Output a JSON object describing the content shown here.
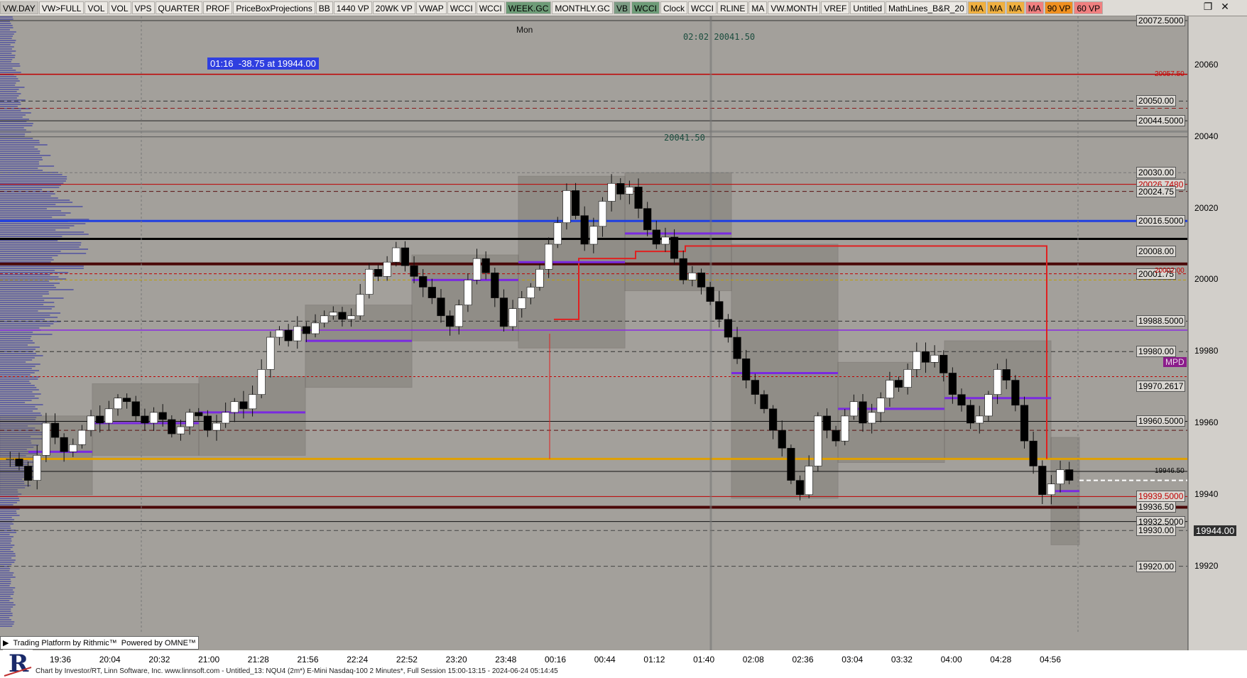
{
  "toolbar": {
    "buttons": [
      {
        "label": "VW.DAY",
        "bg": "#c9c6c1"
      },
      {
        "label": "VW>FULL",
        "bg": "#ece9e4"
      },
      {
        "label": "VOL",
        "bg": "#ece9e4"
      },
      {
        "label": "VOL",
        "bg": "#ece9e4"
      },
      {
        "label": "VPS",
        "bg": "#ece9e4"
      },
      {
        "label": "QUARTER",
        "bg": "#ece9e4"
      },
      {
        "label": "PROF",
        "bg": "#ece9e4"
      },
      {
        "label": "PriceBoxProjections",
        "bg": "#ece9e4"
      },
      {
        "label": "BB",
        "bg": "#ece9e4"
      },
      {
        "label": "1440 VP",
        "bg": "#ece9e4"
      },
      {
        "label": "20WK VP",
        "bg": "#ece9e4"
      },
      {
        "label": "VWAP",
        "bg": "#ece9e4"
      },
      {
        "label": "WCCI",
        "bg": "#ece9e4"
      },
      {
        "label": "WCCI",
        "bg": "#ece9e4"
      },
      {
        "label": "WEEK.GC",
        "bg": "#6e9c78"
      },
      {
        "label": "MONTHLY.GC",
        "bg": "#ece9e4"
      },
      {
        "label": "VB",
        "bg": "#7c9c84"
      },
      {
        "label": "WCCI",
        "bg": "#6e9c78"
      },
      {
        "label": "Clock",
        "bg": "#ece9e4"
      },
      {
        "label": "WCCI",
        "bg": "#ece9e4"
      },
      {
        "label": "RLINE",
        "bg": "#ece9e4"
      },
      {
        "label": "MA",
        "bg": "#ece9e4"
      },
      {
        "label": "VW.MONTH",
        "bg": "#ece9e4"
      },
      {
        "label": "VREF",
        "bg": "#ece9e4"
      },
      {
        "label": "Untitled",
        "bg": "#ece9e4"
      },
      {
        "label": "MathLines_B&R_20",
        "bg": "#ece9e4"
      },
      {
        "label": "MA",
        "bg": "#f0b040"
      },
      {
        "label": "MA",
        "bg": "#f0b040"
      },
      {
        "label": "MA",
        "bg": "#f0b040"
      },
      {
        "label": "MA",
        "bg": "#f08080"
      },
      {
        "label": "90 VP",
        "bg": "#f09020"
      },
      {
        "label": "60 VP",
        "bg": "#f08080"
      }
    ],
    "restore_icon": "restore-icon",
    "close_icon": "close-icon"
  },
  "chart_header": {
    "day_label": "Mon",
    "crosshair_readout": "02:02  20041.50",
    "crosshair_price": "20041.50",
    "info_box": "01:16  -38.75 at 19944.00"
  },
  "axis": {
    "ticks": [
      "20060",
      "20040",
      "20020",
      "20000",
      "19980",
      "19960",
      "19940",
      "19920"
    ]
  },
  "price_tags": [
    {
      "label": "20072.5000",
      "price": 20072.5
    },
    {
      "label": "20050.00",
      "price": 20050
    },
    {
      "label": "20044.5000",
      "price": 20044.5
    },
    {
      "label": "20030.00",
      "price": 20030
    },
    {
      "label": "20026.7480",
      "price": 20026.748,
      "color": "#c00000"
    },
    {
      "label": "20024.75",
      "price": 20024.75
    },
    {
      "label": "20016.5000",
      "price": 20016.5
    },
    {
      "label": "20008.00",
      "price": 20008
    },
    {
      "label": "20001.75",
      "price": 20001.75
    },
    {
      "label": "19988.5000",
      "price": 19988.5
    },
    {
      "label": "19980.00",
      "price": 19980
    },
    {
      "label": "19970.2617",
      "price": 19970.2617
    },
    {
      "label": "19960.5000",
      "price": 19960.5
    },
    {
      "label": "19939.5000",
      "price": 19939.5,
      "color": "#c00000"
    },
    {
      "label": "19936.50",
      "price": 19936.5
    },
    {
      "label": "19932.5000",
      "price": 19932.5
    },
    {
      "label": "19930.00",
      "price": 19930
    },
    {
      "label": "19920.00",
      "price": 19920
    }
  ],
  "red_tags": [
    {
      "label": "20057.50",
      "price": 20057.5
    },
    {
      "label": "20002.00",
      "price": 20002.5
    }
  ],
  "small_tags": [
    {
      "label": "19946.50",
      "price": 19946.5
    }
  ],
  "last_price": "19944.00",
  "mpd_label": "MPD",
  "time_labels": [
    "19:36",
    "20:04",
    "20:32",
    "21:00",
    "21:28",
    "21:56",
    "22:24",
    "22:52",
    "23:20",
    "23:48",
    "00:16",
    "00:44",
    "01:12",
    "01:40",
    "02:08",
    "02:36",
    "03:04",
    "03:32",
    "04:00",
    "04:28",
    "04:56"
  ],
  "rithmic": {
    "text1": "Trading Platform by Rithmic™",
    "text2": "Powered by OMNE™"
  },
  "footer": "Chart by Investor/RT, Linn Software, Inc. www.linnsoft.com - Untitled_13: NQU4 (2m*) E-Mini Nasdaq-100 2 Minutes*, Full Session 15:00-13:15 - 2024-06-24 05:14:45",
  "colors": {
    "bg": "#a3a09b",
    "up": "#ffffff",
    "down": "#000000",
    "vwap_blue": "#1f3fe0",
    "gold": "#e0a000",
    "purple": "#8a2be2",
    "maroon": "#4a0808",
    "red": "#e02020"
  }
}
